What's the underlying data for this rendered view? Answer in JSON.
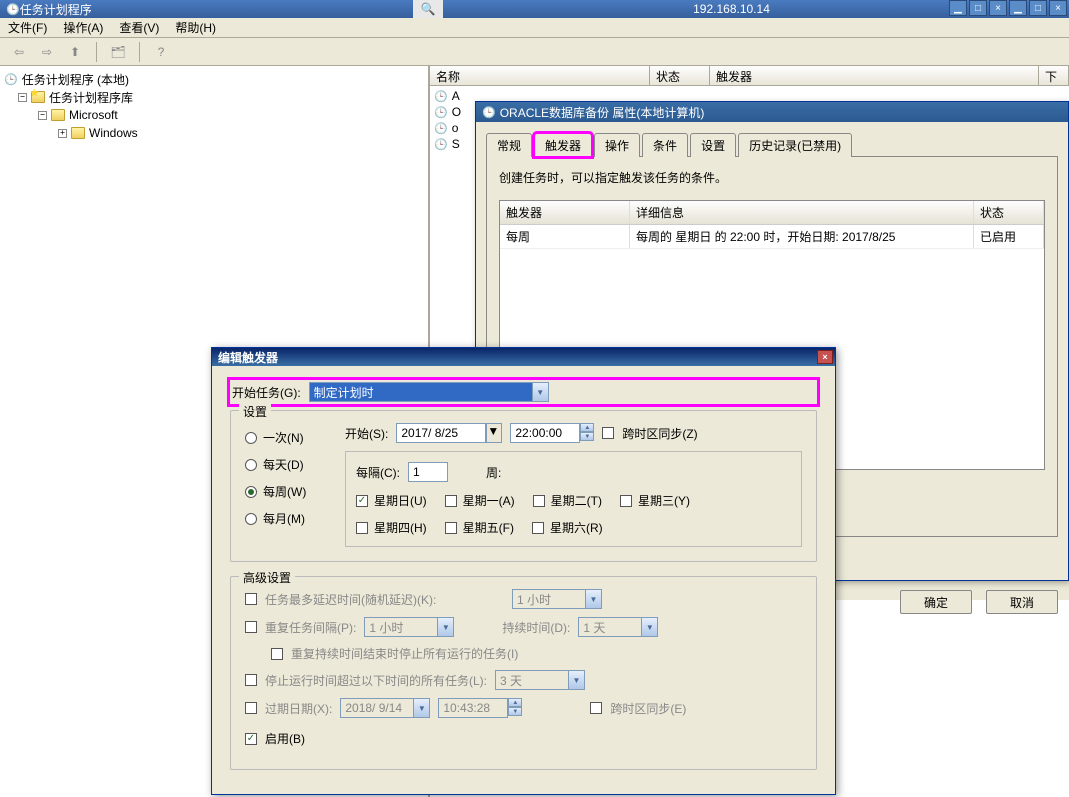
{
  "outer_window": {
    "title": "任务计划程序",
    "controls": {
      "min": "▁",
      "max": "□",
      "close": "×"
    }
  },
  "inner_window": {
    "address": "192.168.10.14",
    "pin_icon": "📌",
    "search_icon": "🔍",
    "controls": {
      "min": "▁",
      "max": "□",
      "close": "×"
    }
  },
  "menubar": {
    "file": "文件(F)",
    "action": "操作(A)",
    "view": "查看(V)",
    "help": "帮助(H)"
  },
  "toolbar": {
    "back": "⇦",
    "fwd": "⇨",
    "up": "⬆",
    "refresh": "🗂",
    "help": "?"
  },
  "tree": {
    "root": "任务计划程序 (本地)",
    "lib": "任务计划程序库",
    "microsoft": "Microsoft",
    "windows": "Windows",
    "exp_minus": "−",
    "exp_plus": "+"
  },
  "right_cols": {
    "name": "名称",
    "state": "状态",
    "triggers": "触发器",
    "next": "下"
  },
  "right_rows": {
    "r1": "A",
    "r2": "O",
    "r3": "o",
    "r4": "S"
  },
  "props": {
    "title": "ORACLE数据库备份 属性(本地计算机)",
    "tabs": {
      "general": "常规",
      "triggers": "触发器",
      "actions": "操作",
      "conditions": "条件",
      "settings": "设置",
      "history": "历史记录(已禁用)"
    },
    "desc": "创建任务时，可以指定触发该任务的条件。",
    "table": {
      "col_trigger": "触发器",
      "col_detail": "详细信息",
      "col_state": "状态",
      "row_trigger": "每周",
      "row_detail": "每周的 星期日 的 22:00 时，开始日期: 2017/8/25",
      "row_state": "已启用"
    },
    "ok": "确定",
    "cancel": "取消"
  },
  "edit": {
    "title": "编辑触发器",
    "close": "×",
    "start_task_label": "开始任务(G):",
    "start_task_value": "制定计划时",
    "settings_legend": "设置",
    "radios": {
      "once": "一次(N)",
      "daily": "每天(D)",
      "weekly": "每周(W)",
      "monthly": "每月(M)"
    },
    "start_label": "开始(S):",
    "start_date": "2017/ 8/25",
    "start_time": "22:00:00",
    "tz_sync": "跨时区同步(Z)",
    "every_label": "每隔(C):",
    "every_value": "1",
    "week_label": "周:",
    "days": {
      "sun": "星期日(U)",
      "mon": "星期一(A)",
      "tue": "星期二(T)",
      "wed": "星期三(Y)",
      "thu": "星期四(H)",
      "fri": "星期五(F)",
      "sat": "星期六(R)"
    },
    "adv_legend": "高级设置",
    "delay_label": "任务最多延迟时间(随机延迟)(K):",
    "delay_value": "1 小时",
    "repeat_label": "重复任务间隔(P):",
    "repeat_value": "1 小时",
    "duration_label": "持续时间(D):",
    "duration_value": "1 天",
    "stop_after_repeat": "重复持续时间结束时停止所有运行的任务(I)",
    "stop_if_longer": "停止运行时间超过以下时间的所有任务(L):",
    "stop_value": "3 天",
    "expire_label": "过期日期(X):",
    "expire_date": "2018/ 9/14",
    "expire_time": "10:43:28",
    "tz_sync2": "跨时区同步(E)",
    "enabled": "启用(B)"
  }
}
